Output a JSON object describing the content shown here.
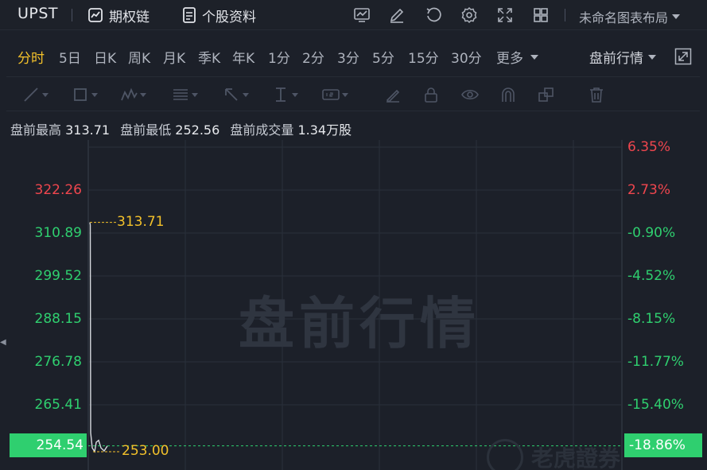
{
  "header": {
    "ticker": "UPST",
    "options_chain": "期权链",
    "stock_profile": "个股资料",
    "layout_name": "未命名图表布局"
  },
  "icons": [
    "chart-indicator-icon",
    "edit-icon",
    "refresh-icon",
    "gear-icon",
    "fullscreen-icon",
    "grid-layout-icon",
    "line-tool-icon",
    "rect-tool-icon",
    "wave-tool-icon",
    "fib-tool-icon",
    "arrow-tool-icon",
    "measure-tool-icon",
    "text-tool-icon",
    "brush-icon",
    "lock-icon",
    "eye-icon",
    "magnet-icon",
    "group-icon",
    "trash-icon",
    "expand-icon"
  ],
  "periods": [
    {
      "label": "分时",
      "active": true
    },
    {
      "label": "5日"
    },
    {
      "label": "日K"
    },
    {
      "label": "周K"
    },
    {
      "label": "月K"
    },
    {
      "label": "季K"
    },
    {
      "label": "年K"
    },
    {
      "label": "1分"
    },
    {
      "label": "2分"
    },
    {
      "label": "3分"
    },
    {
      "label": "5分"
    },
    {
      "label": "15分"
    },
    {
      "label": "30分"
    },
    {
      "label": "更多"
    }
  ],
  "session_select": "盘前行情",
  "stats": {
    "high_label": "盘前最高",
    "high_value": "313.71",
    "low_label": "盘前最低",
    "low_value": "252.56",
    "volume_label": "盘前成交量",
    "volume_value": "1.34万股"
  },
  "chart_data": {
    "type": "line",
    "watermark": "盘前行情",
    "brand_watermark": "老虎證券",
    "y_left_ticks": [
      "322.26",
      "310.89",
      "299.52",
      "288.15",
      "276.78",
      "265.41"
    ],
    "y_right_ticks": [
      "6.35%",
      "2.73%",
      "-0.90%",
      "-4.52%",
      "-8.15%",
      "-11.77%",
      "-15.40%"
    ],
    "current_price": "254.54",
    "current_pct": "-18.86%",
    "high_marker": "313.71",
    "low_marker": "253.00",
    "ylim": [
      248,
      327
    ],
    "series": [
      {
        "values": [
          313.71,
          313.0,
          258.0,
          254.0,
          253.0,
          255.5,
          256.0,
          254.0,
          253.2,
          254.5
        ]
      }
    ],
    "colors": {
      "up": "#f0464e",
      "down": "#2fcf6f",
      "line": "#d8dbe0",
      "marker": "#f3c12a"
    }
  }
}
